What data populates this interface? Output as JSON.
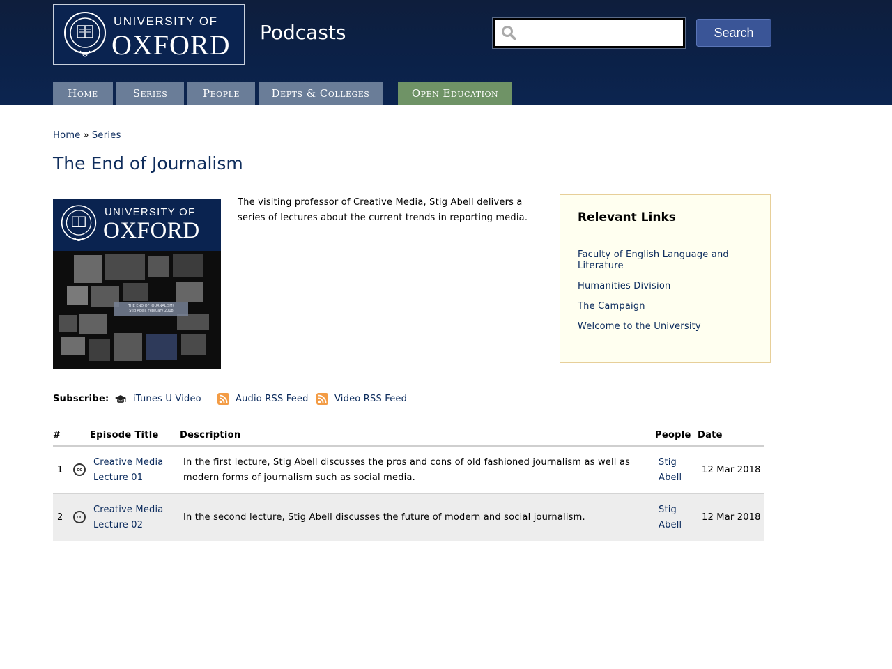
{
  "header": {
    "logo_univ": "UNIVERSITY OF",
    "logo_oxford": "OXFORD",
    "site_title": "Podcasts",
    "search_placeholder": "",
    "search_button": "Search",
    "nav": [
      {
        "label": "Home"
      },
      {
        "label": "Series"
      },
      {
        "label": "People"
      },
      {
        "label": "Depts & Colleges"
      },
      {
        "label": "Open Education"
      }
    ]
  },
  "breadcrumb": {
    "home": "Home",
    "sep": "»",
    "current": "Series"
  },
  "page_title": "The End of Journalism",
  "cover": {
    "univ": "UNIVERSITY OF",
    "oxford": "OXFORD",
    "caption_line1": "THE END OF JOURNALISM?",
    "caption_line2": "Stig Abell, February 2018"
  },
  "description": "The visiting professor of Creative Media, Stig Abell delivers a series of lectures about the current trends in reporting media.",
  "relevant_links": {
    "title": "Relevant Links",
    "items": [
      "Faculty of English Language and Literature",
      "Humanities Division",
      "The Campaign",
      "Welcome to the University"
    ]
  },
  "subscribe": {
    "label": "Subscribe:",
    "itunes": "iTunes U Video",
    "audio_rss": "Audio RSS Feed",
    "video_rss": "Video RSS Feed"
  },
  "episodes": {
    "headers": {
      "num": "#",
      "title": "Episode Title",
      "description": "Description",
      "people": "People",
      "date": "Date"
    },
    "cc_label": "cc",
    "rows": [
      {
        "num": "1",
        "title_line1": "Creative Media",
        "title_line2": "Lecture 01",
        "description": "In the first lecture, Stig Abell discusses the pros and cons of old fashioned journalism as well as modern forms of journalism such as social media.",
        "people_line1": "Stig",
        "people_line2": "Abell",
        "date": "12 Mar 2018"
      },
      {
        "num": "2",
        "title_line1": "Creative Media",
        "title_line2": "Lecture 02",
        "description": "In the second lecture, Stig Abell discusses the future of modern and social journalism.",
        "people_line1": "Stig",
        "people_line2": "Abell",
        "date": "12 Mar 2018"
      }
    ]
  }
}
